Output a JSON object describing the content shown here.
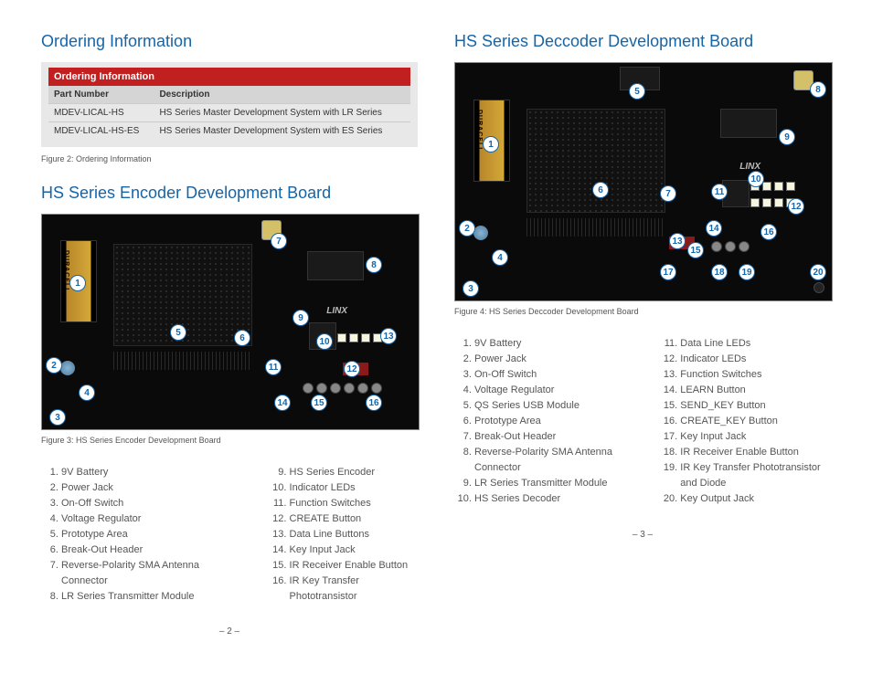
{
  "left": {
    "h_ordering": "Ordering Information",
    "table": {
      "title": "Ordering Information",
      "col1": "Part Number",
      "col2": "Description",
      "rows": [
        {
          "pn": "MDEV-LICAL-HS",
          "desc": "HS Series Master Development System with LR Series"
        },
        {
          "pn": "MDEV-LICAL-HS-ES",
          "desc": "HS Series Master Development System with ES Series"
        }
      ]
    },
    "fig2": "Figure 2: Ordering Information",
    "h_encoder": "HS Series Encoder Development Board",
    "fig3": "Figure 3: HS Series Encoder Development Board",
    "legend_a": [
      "9V Battery",
      "Power Jack",
      "On-Off Switch",
      "Voltage Regulator",
      "Prototype Area",
      "Break-Out Header",
      "Reverse-Polarity SMA Antenna Connector",
      "LR Series Transmitter Module"
    ],
    "legend_b": [
      "HS Series Encoder",
      "Indicator LEDs",
      "Function Switches",
      "CREATE Button",
      "Data Line Buttons",
      "Key Input Jack",
      "IR Receiver Enable Button",
      "IR Key Transfer Phototransistor"
    ],
    "pgnum": "– 2 –"
  },
  "right": {
    "h_decoder": "HS Series Deccoder Development Board",
    "fig4": "Figure 4: HS Series Deccoder Development Board",
    "legend_a": [
      "9V Battery",
      "Power Jack",
      "On-Off Switch",
      "Voltage Regulator",
      "QS Series USB Module",
      "Prototype Area",
      "Break-Out Header",
      "Reverse-Polarity SMA Antenna Connector",
      "LR Series Transmitter Module",
      "HS Series Decoder"
    ],
    "legend_b": [
      "Data Line LEDs",
      "Indicator LEDs",
      "Function Switches",
      "LEARN Button",
      "SEND_KEY Button",
      "CREATE_KEY Button",
      "Key Input Jack",
      "IR Receiver Enable Button",
      "IR Key Transfer Phototransistor and Diode",
      "Key Output Jack"
    ],
    "pgnum": "– 3 –"
  },
  "logo": "LINX"
}
